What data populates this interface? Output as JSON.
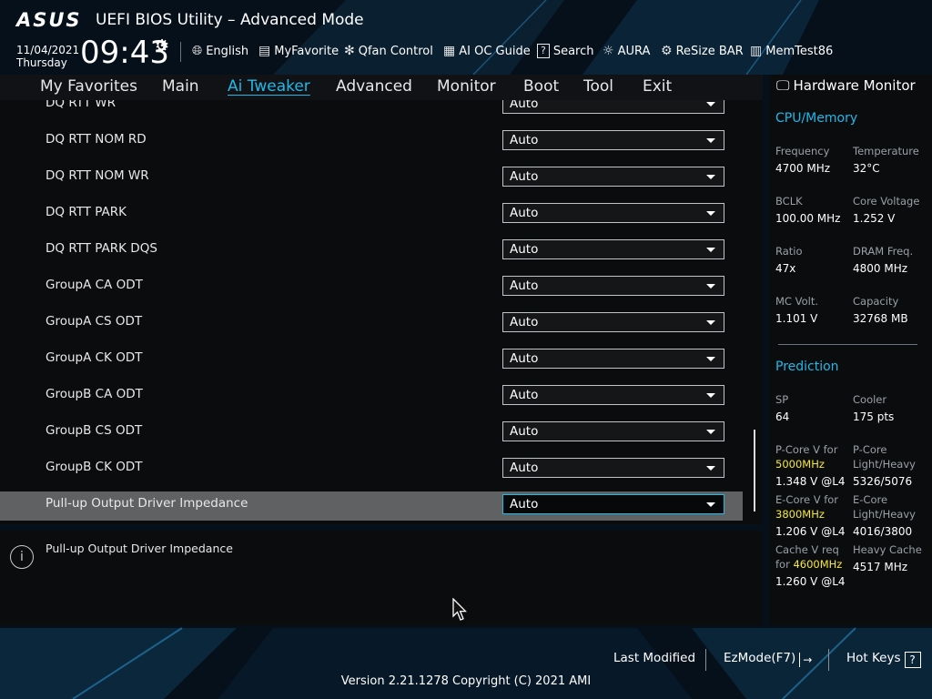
{
  "header": {
    "brand": "ASUS",
    "title": "UEFI BIOS Utility – Advanced Mode",
    "date": "11/04/2021",
    "day": "Thursday",
    "time": "09:43",
    "tools": [
      {
        "icon": "globe-icon",
        "label": "English"
      },
      {
        "icon": "myfavorite-icon",
        "label": "MyFavorite"
      },
      {
        "icon": "fan-icon",
        "label": "Qfan Control"
      },
      {
        "icon": "ai-chip-icon",
        "label": "AI OC Guide"
      },
      {
        "icon": "search-icon",
        "label": "Search"
      },
      {
        "icon": "aura-icon",
        "label": "AURA"
      },
      {
        "icon": "resize-bar-icon",
        "label": "ReSize BAR"
      },
      {
        "icon": "memtest-icon",
        "label": "MemTest86"
      }
    ]
  },
  "menu": {
    "items": [
      "My Favorites",
      "Main",
      "Ai Tweaker",
      "Advanced",
      "Monitor",
      "Boot",
      "Tool",
      "Exit"
    ],
    "active": "Ai Tweaker"
  },
  "settings": [
    {
      "label": "DQ RTT WR",
      "value": "Auto"
    },
    {
      "label": "DQ RTT NOM RD",
      "value": "Auto"
    },
    {
      "label": "DQ RTT NOM WR",
      "value": "Auto"
    },
    {
      "label": "DQ RTT PARK",
      "value": "Auto"
    },
    {
      "label": "DQ RTT PARK DQS",
      "value": "Auto"
    },
    {
      "label": "GroupA CA ODT",
      "value": "Auto"
    },
    {
      "label": "GroupA CS ODT",
      "value": "Auto"
    },
    {
      "label": "GroupA CK ODT",
      "value": "Auto"
    },
    {
      "label": "GroupB CA ODT",
      "value": "Auto"
    },
    {
      "label": "GroupB CS ODT",
      "value": "Auto"
    },
    {
      "label": "GroupB CK ODT",
      "value": "Auto"
    },
    {
      "label": "Pull-up Output Driver Impedance",
      "value": "Auto",
      "selected": true
    }
  ],
  "help": {
    "text": "Pull-up Output Driver Impedance"
  },
  "hw_monitor": {
    "title": "Hardware Monitor",
    "cpu_memory": {
      "section": "CPU/Memory",
      "frequency_label": "Frequency",
      "frequency": "4700 MHz",
      "temperature_label": "Temperature",
      "temperature": "32°C",
      "bclk_label": "BCLK",
      "bclk": "100.00 MHz",
      "core_voltage_label": "Core Voltage",
      "core_voltage": "1.252 V",
      "ratio_label": "Ratio",
      "ratio": "47x",
      "dram_freq_label": "DRAM Freq.",
      "dram_freq": "4800 MHz",
      "mc_volt_label": "MC Volt.",
      "mc_volt": "1.101 V",
      "capacity_label": "Capacity",
      "capacity": "32768 MB"
    },
    "prediction": {
      "section": "Prediction",
      "sp_label": "SP",
      "sp": "64",
      "cooler_label": "Cooler",
      "cooler": "175 pts",
      "pcore_v_label": "P-Core V for",
      "pcore_v_freq": "5000MHz",
      "pcore_v": "1.348 V @L4",
      "pcore_lh_label": "P-Core Light/Heavy",
      "pcore_lh": "5326/5076",
      "ecore_v_label": "E-Core V for",
      "ecore_v_freq": "3800MHz",
      "ecore_v": "1.206 V @L4",
      "ecore_lh_label": "E-Core Light/Heavy",
      "ecore_lh": "4016/3800",
      "cache_v_label": "Cache V req for",
      "cache_v_freq": "4600MHz",
      "cache_v": "1.260 V @L4",
      "heavy_cache_label": "Heavy Cache",
      "heavy_cache": "4517 MHz"
    }
  },
  "footer": {
    "last_modified": "Last Modified",
    "ezmode": "EzMode(F7)",
    "ezmode_key": "→",
    "hotkeys": "Hot Keys",
    "hotkeys_key": "?",
    "version": "Version 2.21.1278 Copyright (C) 2021 AMI"
  },
  "colors": {
    "accent": "#21b8e8",
    "highlight": "#f5e83a",
    "panel": "#0b0c0e",
    "selected_row": "#5f6163"
  }
}
